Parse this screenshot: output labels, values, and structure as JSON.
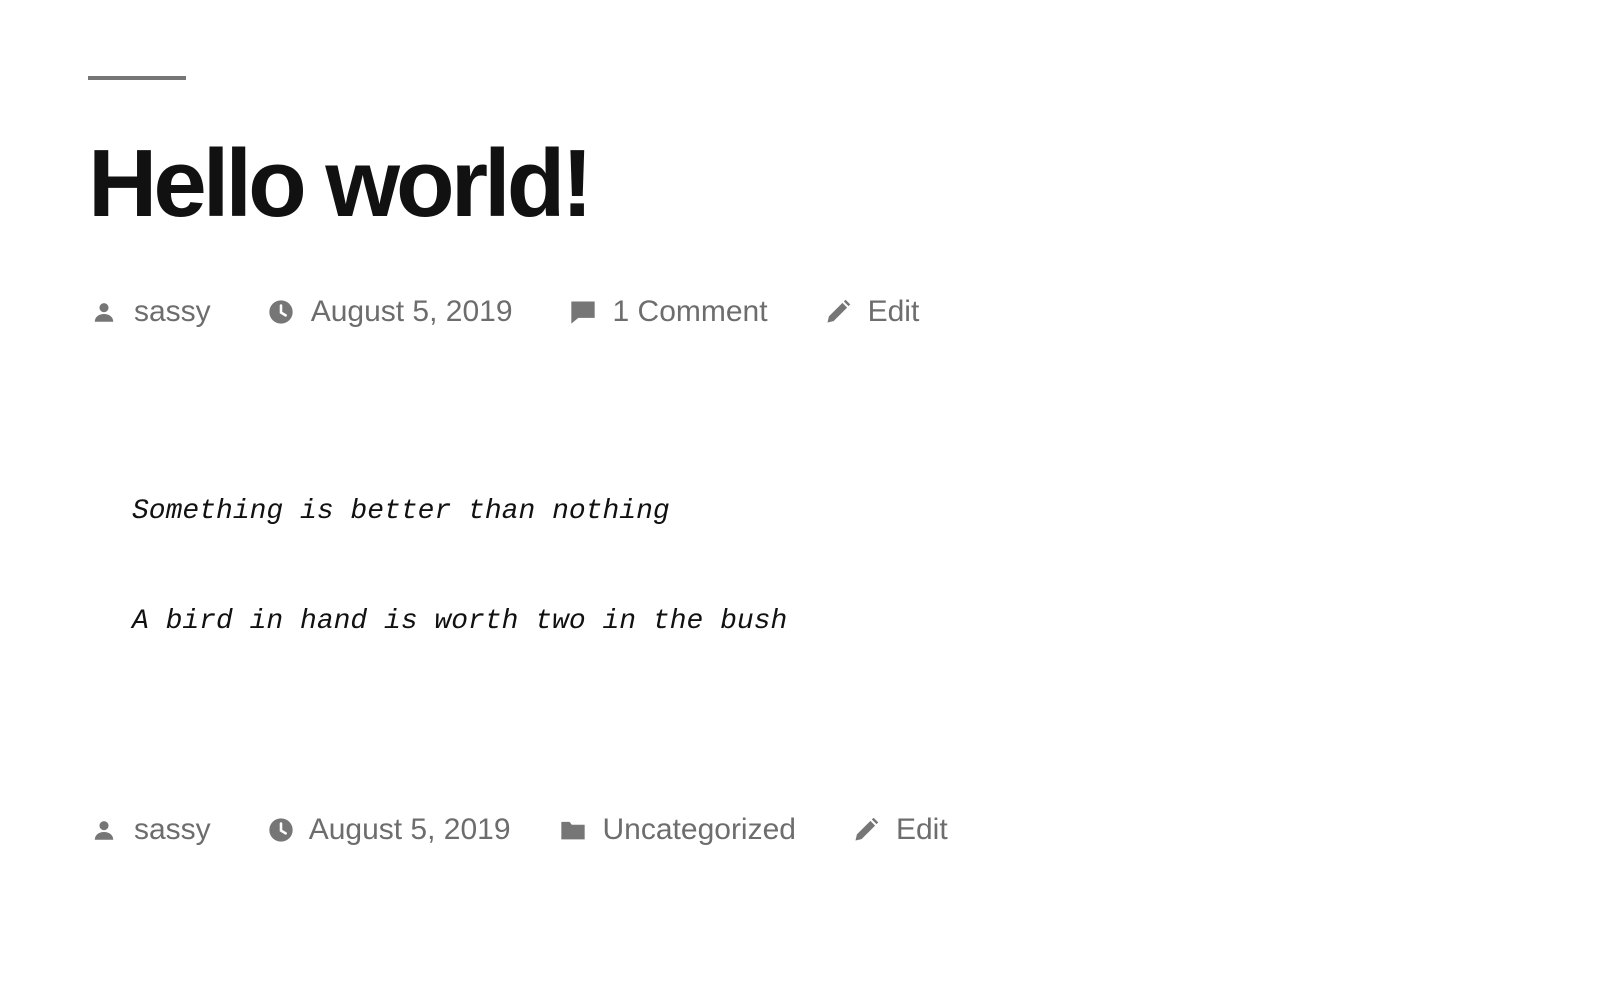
{
  "post": {
    "title": "Hello world!",
    "meta_top": {
      "author": "sassy",
      "date": "August 5, 2019",
      "comments": "1 Comment",
      "edit": "Edit"
    },
    "body_lines": [
      "Something is better than nothing",
      "A bird in hand is worth two in the bush"
    ],
    "meta_bottom": {
      "author": "sassy",
      "date": "August 5, 2019",
      "category": "Uncategorized",
      "edit": "Edit"
    }
  },
  "icons": {
    "author": "user-icon",
    "date": "clock-icon",
    "comments": "comment-icon",
    "edit": "pencil-icon",
    "category": "folder-icon"
  },
  "colors": {
    "title": "#111111",
    "meta": "#6d6d6d",
    "rule": "#767676"
  }
}
